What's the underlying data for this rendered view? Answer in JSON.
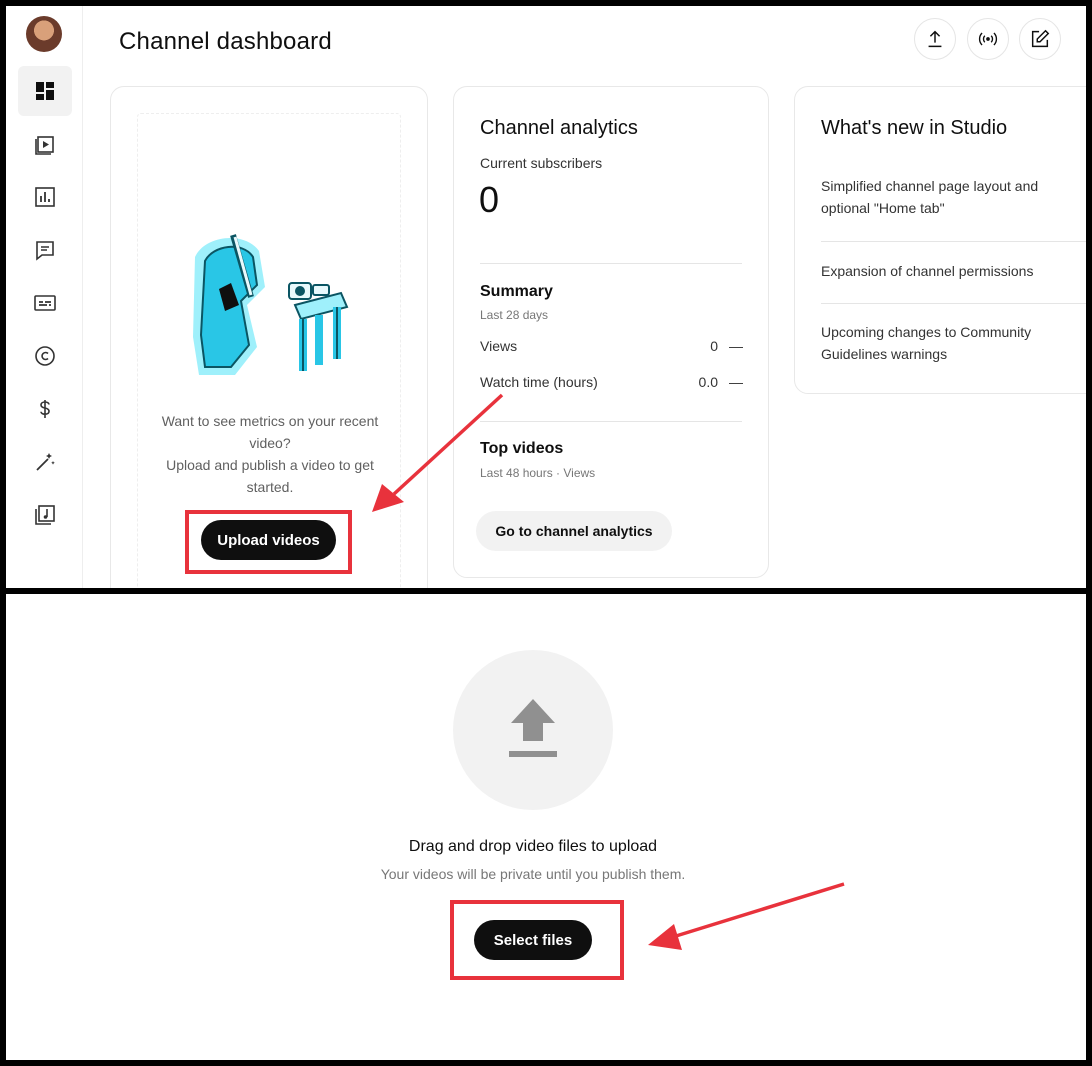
{
  "header": {
    "title": "Channel dashboard",
    "icons": [
      "upload-icon",
      "live-icon",
      "edit-icon"
    ]
  },
  "sidebar": {
    "items": [
      {
        "icon": "dashboard-icon",
        "active": true
      },
      {
        "icon": "content-icon"
      },
      {
        "icon": "analytics-icon"
      },
      {
        "icon": "comments-icon"
      },
      {
        "icon": "subtitles-icon"
      },
      {
        "icon": "copyright-icon"
      },
      {
        "icon": "earn-icon"
      },
      {
        "icon": "customization-icon"
      },
      {
        "icon": "audio-library-icon"
      }
    ]
  },
  "upload_card": {
    "line1": "Want to see metrics on your recent video?",
    "line2": "Upload and publish a video to get started.",
    "button": "Upload videos"
  },
  "analytics_card": {
    "title": "Channel analytics",
    "subscribers_label": "Current subscribers",
    "subscribers_value": "0",
    "summary_title": "Summary",
    "summary_period": "Last 28 days",
    "rows": [
      {
        "label": "Views",
        "value": "0",
        "trend": "—"
      },
      {
        "label": "Watch time (hours)",
        "value": "0.0",
        "trend": "—"
      }
    ],
    "top_videos_title": "Top videos",
    "top_videos_period": "Last 48 hours · Views",
    "button": "Go to channel analytics"
  },
  "news_card": {
    "title": "What's new in Studio",
    "items": [
      "Simplified channel page layout and optional \"Home tab\"",
      "Expansion of channel permissions",
      "Upcoming changes to Community Guidelines warnings"
    ]
  },
  "upload_dialog": {
    "icon": "upload-arrow-icon",
    "drag_text": "Drag and drop video files to upload",
    "private_text": "Your videos will be private until you publish them.",
    "button": "Select files"
  },
  "colors": {
    "highlight": "#e8323c",
    "button_dark": "#0f0f0f",
    "illustration": "#29c6e6"
  }
}
